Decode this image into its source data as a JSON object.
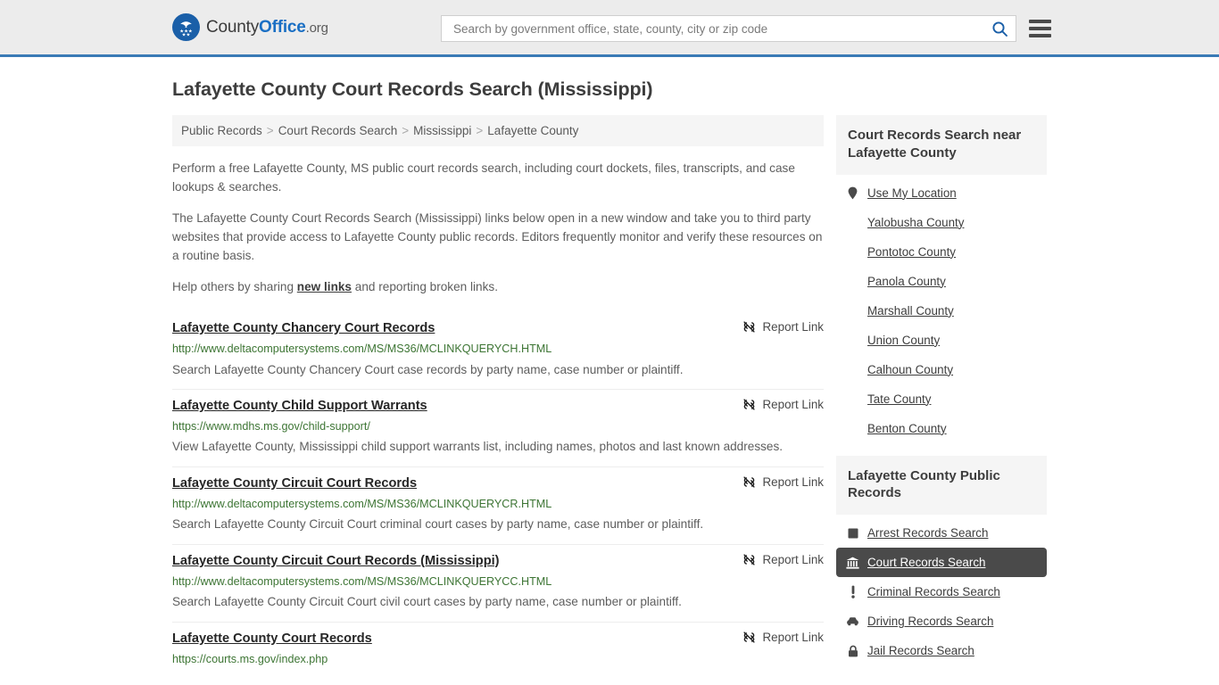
{
  "header": {
    "logo": {
      "part1": "County",
      "part2": "Office",
      "part3": ".org",
      "icon": "eagle-seal-icon"
    },
    "search": {
      "placeholder": "Search by government office, state, county, city or zip code",
      "value": "",
      "icon": "search-icon"
    },
    "menu_icon": "hamburger-menu-icon"
  },
  "page": {
    "title": "Lafayette County Court Records Search (Mississippi)"
  },
  "breadcrumb": {
    "items": [
      "Public Records",
      "Court Records Search",
      "Mississippi",
      "Lafayette County"
    ],
    "separator": ">"
  },
  "intro": {
    "p1": "Perform a free Lafayette County, MS public court records search, including court dockets, files, transcripts, and case lookups & searches.",
    "p2": "The Lafayette County Court Records Search (Mississippi) links below open in a new window and take you to third party websites that provide access to Lafayette County public records. Editors frequently monitor and verify these resources on a routine basis.",
    "p3_before": "Help others by sharing ",
    "p3_link": "new links",
    "p3_after": " and reporting broken links."
  },
  "results": {
    "report_label": "Report Link",
    "report_icon": "broken-link-icon",
    "items": [
      {
        "title": "Lafayette County Chancery Court Records",
        "url": "http://www.deltacomputersystems.com/MS/MS36/MCLINKQUERYCH.HTML",
        "desc": "Search Lafayette County Chancery Court case records by party name, case number or plaintiff."
      },
      {
        "title": "Lafayette County Child Support Warrants",
        "url": "https://www.mdhs.ms.gov/child-support/",
        "desc": "View Lafayette County, Mississippi child support warrants list, including names, photos and last known addresses."
      },
      {
        "title": "Lafayette County Circuit Court Records",
        "url": "http://www.deltacomputersystems.com/MS/MS36/MCLINKQUERYCR.HTML",
        "desc": "Search Lafayette County Circuit Court criminal court cases by party name, case number or plaintiff."
      },
      {
        "title": "Lafayette County Circuit Court Records (Mississippi)",
        "url": "http://www.deltacomputersystems.com/MS/MS36/MCLINKQUERYCC.HTML",
        "desc": "Search Lafayette County Circuit Court civil court cases by party name, case number or plaintiff."
      },
      {
        "title": "Lafayette County Court Records",
        "url": "https://courts.ms.gov/index.php",
        "desc": ""
      }
    ]
  },
  "sidebar": {
    "nearby": {
      "title": "Court Records Search near Lafayette County",
      "items": [
        {
          "label": "Use My Location",
          "icon": "map-pin-icon"
        },
        {
          "label": "Yalobusha County",
          "icon": ""
        },
        {
          "label": "Pontotoc County",
          "icon": ""
        },
        {
          "label": "Panola County",
          "icon": ""
        },
        {
          "label": "Marshall County",
          "icon": ""
        },
        {
          "label": "Union County",
          "icon": ""
        },
        {
          "label": "Calhoun County",
          "icon": ""
        },
        {
          "label": "Tate County",
          "icon": ""
        },
        {
          "label": "Benton County",
          "icon": ""
        }
      ]
    },
    "public_records": {
      "title": "Lafayette County Public Records",
      "items": [
        {
          "label": "Arrest Records Search",
          "icon": "square-icon",
          "active": false
        },
        {
          "label": "Court Records Search",
          "icon": "courthouse-icon",
          "active": true
        },
        {
          "label": "Criminal Records Search",
          "icon": "exclamation-icon",
          "active": false
        },
        {
          "label": "Driving Records Search",
          "icon": "car-icon",
          "active": false
        },
        {
          "label": "Jail Records Search",
          "icon": "lock-icon",
          "active": false
        }
      ]
    }
  },
  "colors": {
    "brand_blue": "#1a6fc4",
    "header_border": "#3a7ab5",
    "header_bg": "#ececec",
    "url_green": "#3d7534",
    "active_bg": "#4a4a4a"
  }
}
